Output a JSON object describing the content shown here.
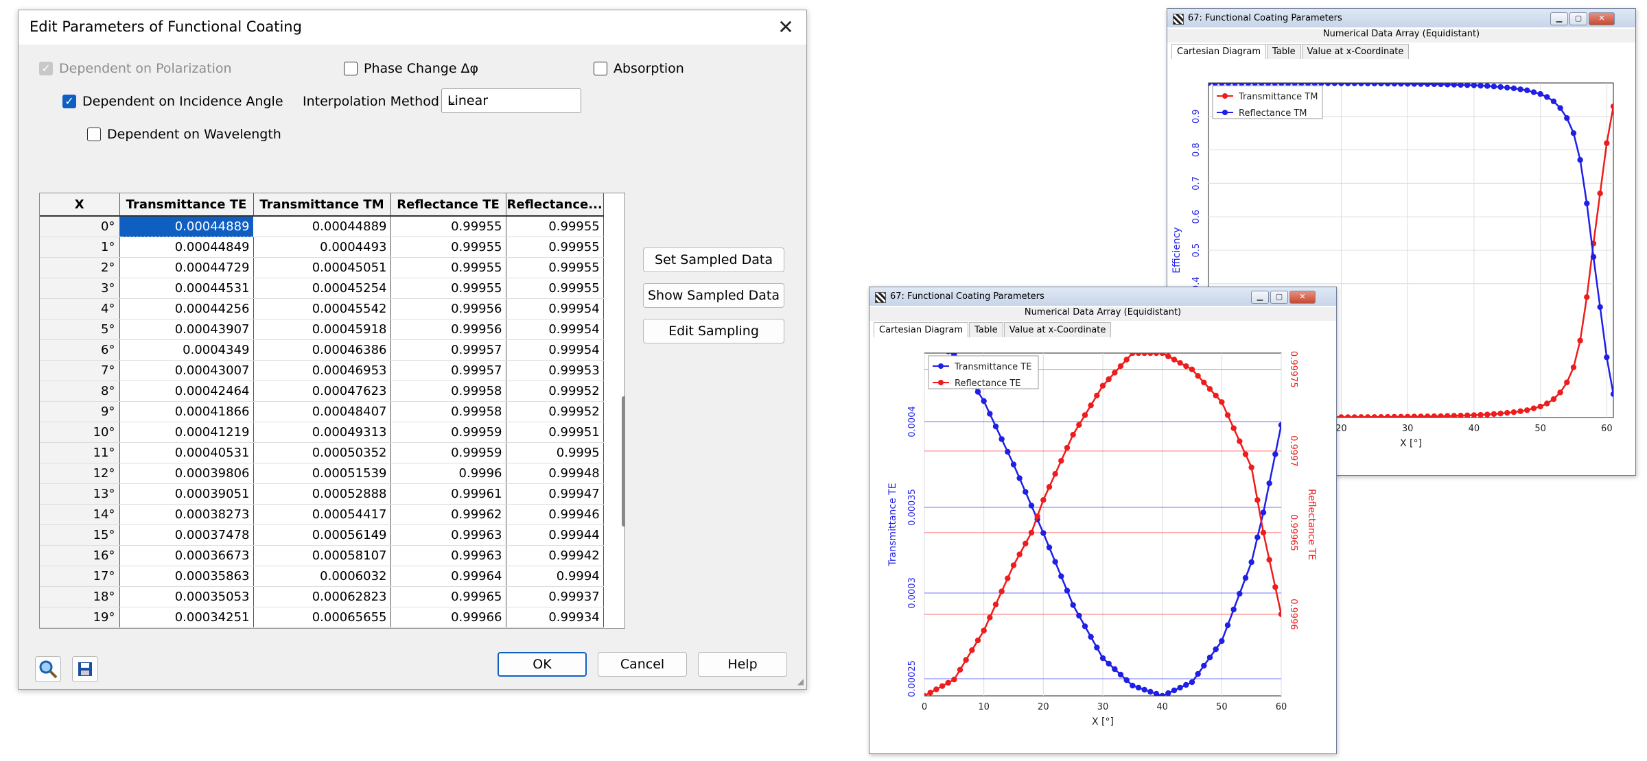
{
  "dialog": {
    "title": "Edit Parameters of Functional Coating",
    "close_glyph": "✕",
    "options": {
      "dependent_on_polarization": {
        "label": "Dependent on Polarization",
        "checked": true,
        "disabled": true
      },
      "phase_change": {
        "label": "Phase Change Δφ",
        "checked": false
      },
      "absorption": {
        "label": "Absorption",
        "checked": false
      },
      "dependent_on_incidence_angle": {
        "label": "Dependent on Incidence Angle",
        "checked": true
      },
      "dependent_on_wavelength": {
        "label": "Dependent on Wavelength",
        "checked": false
      }
    },
    "interpolation": {
      "label": "Interpolation Method",
      "value": "Linear"
    },
    "table": {
      "columns": [
        "X",
        "Transmittance TE",
        "Transmittance TM",
        "Reflectance TE",
        "Reflectance..."
      ],
      "rows": [
        [
          "0°",
          "0.00044889",
          "0.00044889",
          "0.99955",
          "0.99955"
        ],
        [
          "1°",
          "0.00044849",
          "0.0004493",
          "0.99955",
          "0.99955"
        ],
        [
          "2°",
          "0.00044729",
          "0.00045051",
          "0.99955",
          "0.99955"
        ],
        [
          "3°",
          "0.00044531",
          "0.00045254",
          "0.99955",
          "0.99955"
        ],
        [
          "4°",
          "0.00044256",
          "0.00045542",
          "0.99956",
          "0.99954"
        ],
        [
          "5°",
          "0.00043907",
          "0.00045918",
          "0.99956",
          "0.99954"
        ],
        [
          "6°",
          "0.0004349",
          "0.00046386",
          "0.99957",
          "0.99954"
        ],
        [
          "7°",
          "0.00043007",
          "0.00046953",
          "0.99957",
          "0.99953"
        ],
        [
          "8°",
          "0.00042464",
          "0.00047623",
          "0.99958",
          "0.99952"
        ],
        [
          "9°",
          "0.00041866",
          "0.00048407",
          "0.99958",
          "0.99952"
        ],
        [
          "10°",
          "0.00041219",
          "0.00049313",
          "0.99959",
          "0.99951"
        ],
        [
          "11°",
          "0.00040531",
          "0.00050352",
          "0.99959",
          "0.9995"
        ],
        [
          "12°",
          "0.00039806",
          "0.00051539",
          "0.9996",
          "0.99948"
        ],
        [
          "13°",
          "0.00039051",
          "0.00052888",
          "0.99961",
          "0.99947"
        ],
        [
          "14°",
          "0.00038273",
          "0.00054417",
          "0.99962",
          "0.99946"
        ],
        [
          "15°",
          "0.00037478",
          "0.00056149",
          "0.99963",
          "0.99944"
        ],
        [
          "16°",
          "0.00036673",
          "0.00058107",
          "0.99963",
          "0.99942"
        ],
        [
          "17°",
          "0.00035863",
          "0.0006032",
          "0.99964",
          "0.9994"
        ],
        [
          "18°",
          "0.00035053",
          "0.00062823",
          "0.99965",
          "0.99937"
        ],
        [
          "19°",
          "0.00034251",
          "0.00065655",
          "0.99966",
          "0.99934"
        ]
      ]
    },
    "buttons": {
      "set_sampled": "Set Sampled Data",
      "show_sampled": "Show Sampled Data",
      "edit_sampling": "Edit Sampling",
      "ok": "OK",
      "cancel": "Cancel",
      "help": "Help"
    },
    "tool_icons": [
      "magnifier-icon",
      "save-icon"
    ]
  },
  "windows": [
    {
      "title": "67: Functional Coating Parameters",
      "subtitle": "Numerical Data Array (Equidistant)",
      "tabs": [
        "Cartesian Diagram",
        "Table",
        "Value at x-Coordinate"
      ],
      "active_tab": "Cartesian Diagram"
    },
    {
      "title": "67: Functional Coating Parameters",
      "subtitle": "Numerical Data Array (Equidistant)",
      "tabs": [
        "Cartesian Diagram",
        "Table",
        "Value at x-Coordinate"
      ],
      "active_tab": "Cartesian Diagram"
    }
  ],
  "colors": {
    "blue": "#1f1fe6",
    "red": "#ee1c1c",
    "accent": "#0f5fc2"
  },
  "chart_data": [
    {
      "type": "line",
      "window": 0,
      "xlabel": "X [°]",
      "ylabel": "Efficiency",
      "xlim": [
        0,
        61
      ],
      "ylim": [
        0,
        1.0
      ],
      "x_ticks": [
        "20",
        "30",
        "40",
        "50",
        "60"
      ],
      "y_ticks": [
        "0.4",
        "0.5",
        "0.6",
        "0.7",
        "0.8",
        "0.9"
      ],
      "legend": "top-left",
      "grid": true,
      "series": [
        {
          "name": "Transmittance TM",
          "color": "#ee1c1c",
          "x": [
            0,
            5,
            10,
            15,
            20,
            25,
            30,
            35,
            40,
            42,
            44,
            46,
            48,
            50,
            51,
            52,
            53,
            54,
            55,
            56,
            57,
            58,
            59,
            60,
            61
          ],
          "y": [
            0.0004,
            0.0004,
            0.0005,
            0.0007,
            0.001,
            0.0015,
            0.0025,
            0.004,
            0.007,
            0.009,
            0.012,
            0.016,
            0.022,
            0.033,
            0.042,
            0.055,
            0.075,
            0.105,
            0.15,
            0.23,
            0.36,
            0.52,
            0.67,
            0.82,
            0.93
          ]
        },
        {
          "name": "Reflectance TM",
          "color": "#1f1fe6",
          "x": [
            0,
            5,
            10,
            15,
            20,
            25,
            30,
            35,
            40,
            42,
            44,
            46,
            48,
            50,
            51,
            52,
            53,
            54,
            55,
            56,
            57,
            58,
            59,
            60,
            61
          ],
          "y": [
            0.9996,
            0.9996,
            0.9995,
            0.9993,
            0.999,
            0.9985,
            0.9975,
            0.996,
            0.993,
            0.991,
            0.988,
            0.984,
            0.978,
            0.967,
            0.958,
            0.945,
            0.925,
            0.895,
            0.85,
            0.77,
            0.64,
            0.48,
            0.33,
            0.18,
            0.07
          ]
        }
      ]
    },
    {
      "type": "line",
      "window": 1,
      "xlabel": "X [°]",
      "ylabel": "Transmittance TE",
      "y2label": "Reflectance TE",
      "xlim": [
        0,
        60
      ],
      "ylim": [
        0.00024,
        0.00044
      ],
      "y2lim": [
        0.99955,
        0.99976
      ],
      "x_ticks": [
        "0",
        "10",
        "20",
        "30",
        "40",
        "50",
        "60"
      ],
      "y_ticks": [
        "0.00025",
        "0.0003",
        "0.00035",
        "0.0004"
      ],
      "y2_ticks": [
        "0.9996",
        "0.99965",
        "0.9997",
        "0.99975"
      ],
      "legend": "top-left",
      "grid": true,
      "series": [
        {
          "name": "Transmittance TE",
          "color": "#1f1fe6",
          "axis": "left",
          "x": [
            0,
            5,
            10,
            15,
            18,
            20,
            25,
            30,
            35,
            40,
            45,
            50,
            55,
            57,
            60
          ],
          "y": [
            0.000449,
            0.000439,
            0.000412,
            0.000375,
            0.000351,
            0.000335,
            0.000293,
            0.000262,
            0.000246,
            0.00024,
            0.000248,
            0.000272,
            0.000318,
            0.000347,
            0.000398
          ]
        },
        {
          "name": "Reflectance TE",
          "color": "#ee1c1c",
          "axis": "right",
          "x": [
            0,
            5,
            10,
            15,
            18,
            20,
            25,
            30,
            35,
            40,
            45,
            50,
            55,
            57,
            60
          ],
          "y": [
            0.99955,
            0.99956,
            0.99959,
            0.99963,
            0.99965,
            0.99967,
            0.99971,
            0.99974,
            0.99976,
            0.99976,
            0.99975,
            0.99973,
            0.99969,
            0.99965,
            0.9996
          ]
        }
      ]
    }
  ]
}
